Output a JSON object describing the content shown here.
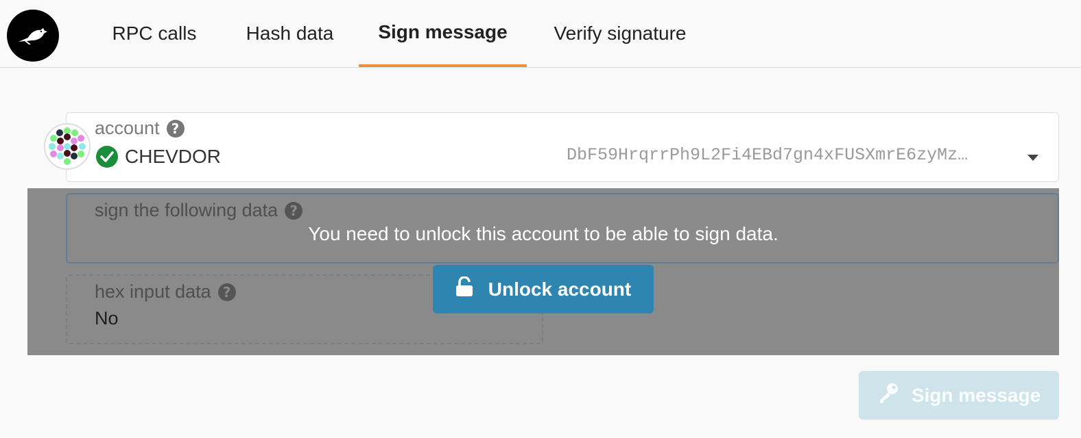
{
  "header": {
    "tabs": [
      {
        "label": "RPC calls",
        "active": false
      },
      {
        "label": "Hash data",
        "active": false
      },
      {
        "label": "Sign message",
        "active": true
      },
      {
        "label": "Verify signature",
        "active": false
      }
    ],
    "active_tab_color": "#e8913d"
  },
  "account": {
    "label": "account",
    "name": "CHEVDOR",
    "address": "DbF59HrqrrPh9L2Fi4EBd7gn4xFUSXmrE6zyMz…",
    "verified": true
  },
  "sign_data": {
    "label": "sign the following data"
  },
  "hex_input": {
    "label": "hex input data",
    "value": "No"
  },
  "overlay": {
    "message": "You need to unlock this account to be able to sign data.",
    "unlock_label": "Unlock account"
  },
  "actions": {
    "sign_label": "Sign message",
    "sign_enabled": false
  },
  "icons": {
    "logo": "bird-logo-icon",
    "help": "question-circle-icon",
    "verified": "check-circle-icon",
    "unlock": "unlock-icon",
    "sign": "key-icon",
    "dropdown": "caret-down-icon"
  },
  "colors": {
    "accent": "#e8913d",
    "primary_button": "#2e86b0",
    "disabled_button": "#cfe3ea",
    "overlay": "#8a8a8a",
    "verified": "#1c8e3b"
  }
}
